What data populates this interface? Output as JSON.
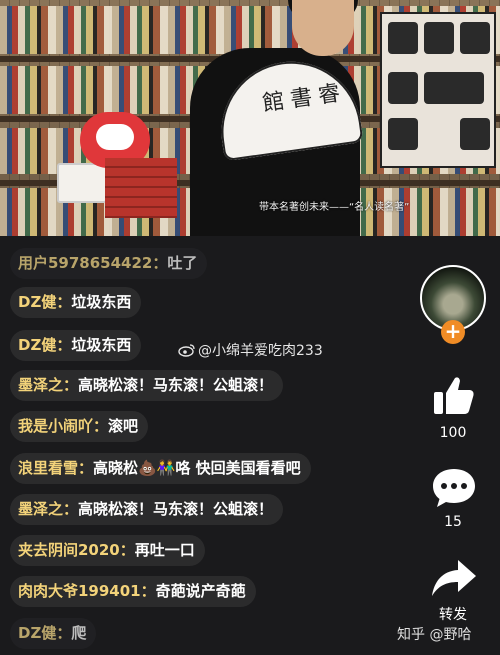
{
  "video": {
    "fan_text": "館書睿",
    "subtitle": "带本名著创未来——“名人读名著”"
  },
  "watermark": "@小绵羊爱吃肉233",
  "comments": [
    {
      "user": "用户5978654422：",
      "text": "吐了"
    },
    {
      "user": "DZ健：",
      "text": "垃圾东西"
    },
    {
      "user": "DZ健：",
      "text": "垃圾东西"
    },
    {
      "user": "墨泽之：",
      "text": "高晓松滚！马东滚！公蛆滚！"
    },
    {
      "user": "我是小闹吖：",
      "text": "滚吧"
    },
    {
      "user": "浪里看雪：",
      "text": "高晓松💩👫咯 快回美国看看吧"
    },
    {
      "user": "墨泽之：",
      "text": "高晓松滚！马东滚！公蛆滚！"
    },
    {
      "user": "夹去阴间2020：",
      "text": "再吐一口"
    },
    {
      "user": "肉肉大爷199401：",
      "text": "奇葩说产奇葩"
    },
    {
      "user": "DZ健：",
      "text": "爬"
    }
  ],
  "rail": {
    "likes": "100",
    "comments": "15",
    "share_label": "转发"
  },
  "corner_watermark": "知乎 @野哈",
  "icons": {
    "follow": "plus-icon",
    "like": "thumbs-up-icon",
    "comment": "speech-bubble-icon",
    "share": "share-arrow-icon"
  },
  "colors": {
    "username": "#f3d37a",
    "follow_button": "#f08c26",
    "background": "#1a1a1c"
  }
}
